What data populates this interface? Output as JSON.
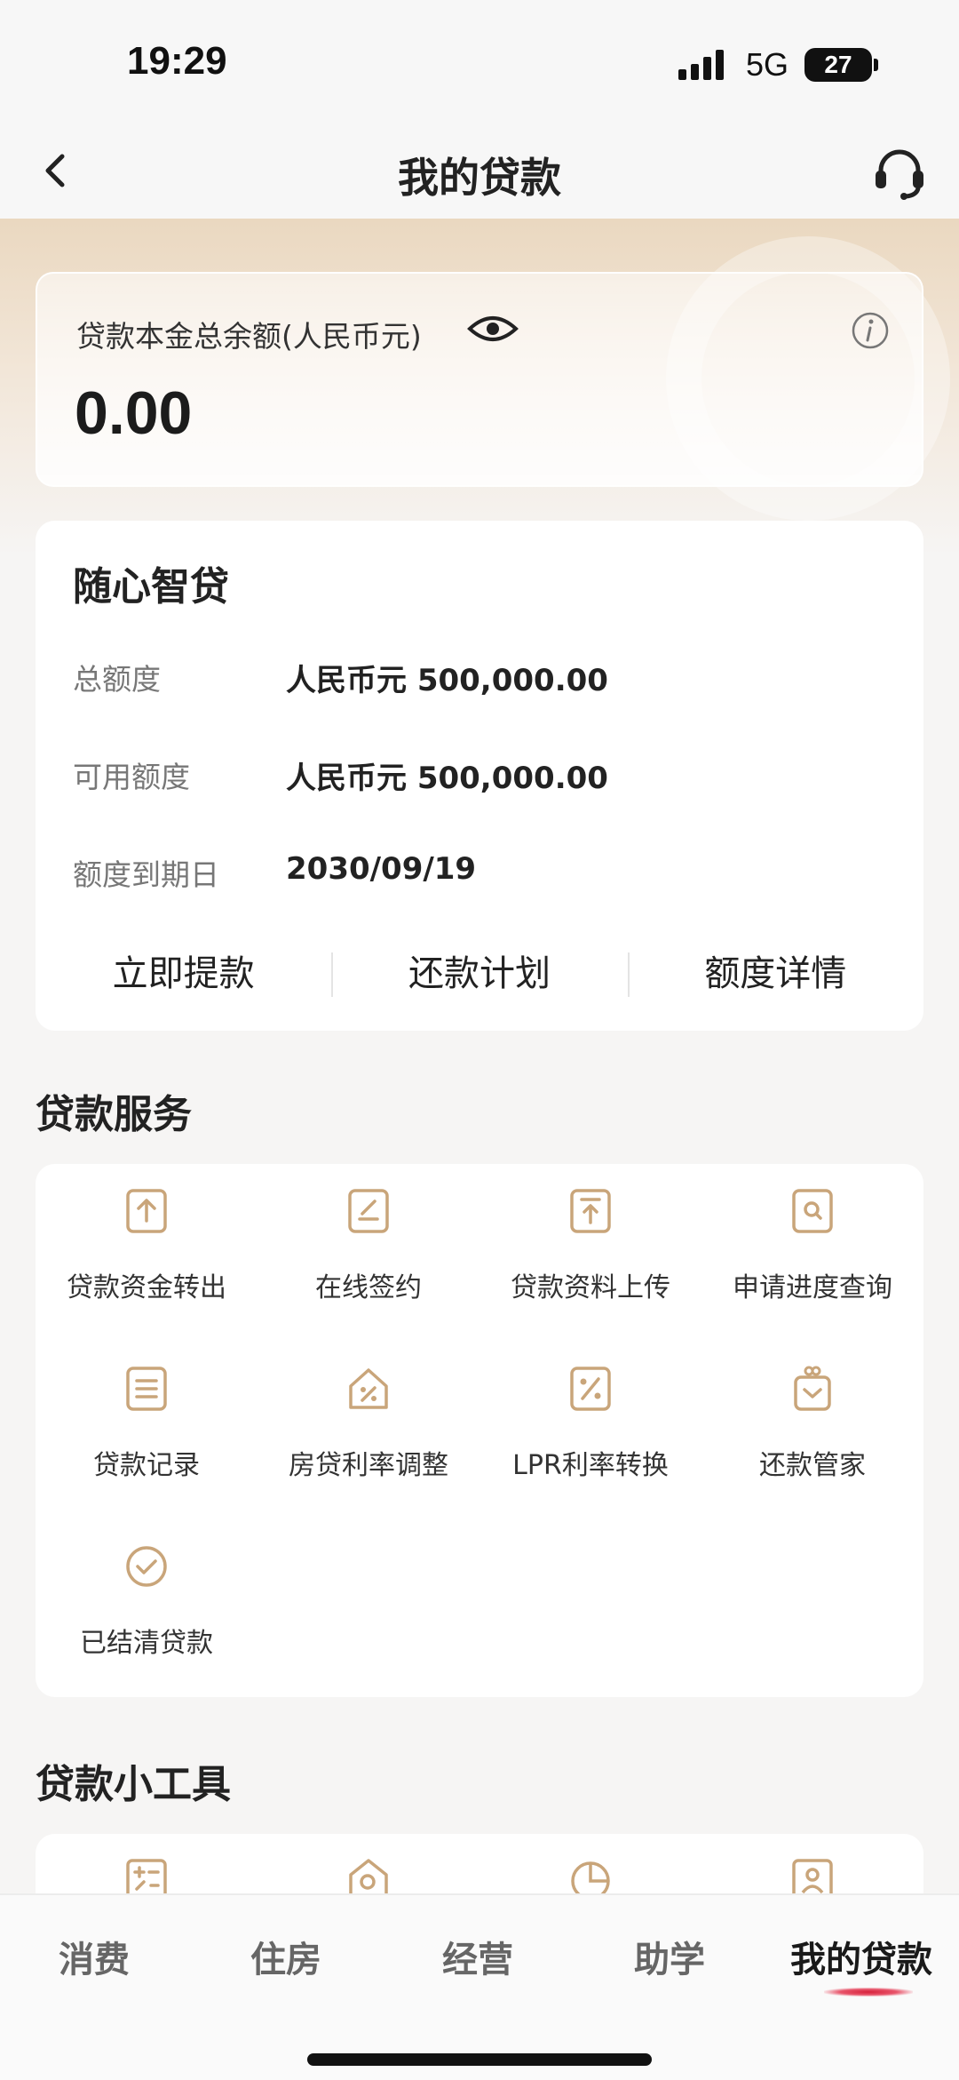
{
  "status": {
    "time": "19:29",
    "network": "5G",
    "battery": "27"
  },
  "nav": {
    "title": "我的贷款"
  },
  "balance": {
    "label": "贷款本金总余额(人民币元)",
    "amount": "0.00"
  },
  "loan": {
    "title": "随心智贷",
    "rows": [
      {
        "label": "总额度",
        "value": "人民币元 500,000.00"
      },
      {
        "label": "可用额度",
        "value": "人民币元 500,000.00"
      },
      {
        "label": "额度到期日",
        "value": "2030/09/19"
      }
    ],
    "actions": [
      "立即提款",
      "还款计划",
      "额度详情"
    ]
  },
  "services": {
    "title": "贷款服务",
    "items": [
      {
        "label": "贷款资金转出",
        "icon": "transfer-out-icon"
      },
      {
        "label": "在线签约",
        "icon": "sign-icon"
      },
      {
        "label": "贷款资料上传",
        "icon": "upload-icon"
      },
      {
        "label": "申请进度查询",
        "icon": "search-doc-icon"
      },
      {
        "label": "贷款记录",
        "icon": "record-icon"
      },
      {
        "label": "房贷利率调整",
        "icon": "house-rate-icon"
      },
      {
        "label": "LPR利率转换",
        "icon": "rate-convert-icon"
      },
      {
        "label": "还款管家",
        "icon": "repay-butler-icon"
      },
      {
        "label": "已结清贷款",
        "icon": "check-circle-icon"
      }
    ]
  },
  "tools": {
    "title": "贷款小工具"
  },
  "tabs": [
    "消费",
    "住房",
    "经营",
    "助学",
    "我的贷款"
  ],
  "colors": {
    "accent": "#c9a57a",
    "tab_indicator": "#d6213b"
  }
}
